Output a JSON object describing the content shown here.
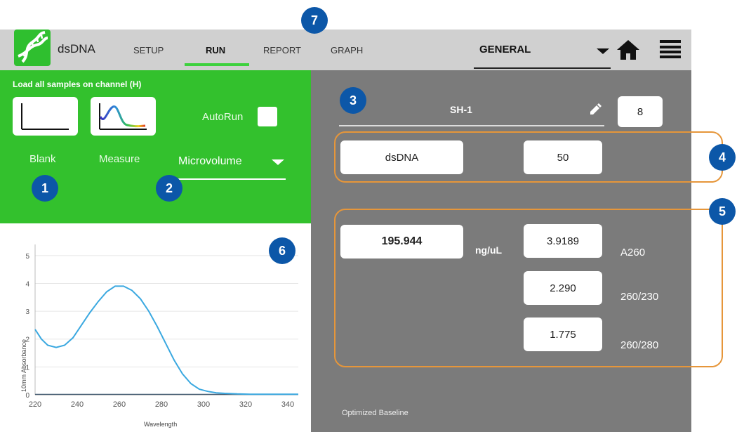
{
  "header": {
    "app_title": "dsDNA",
    "tabs": [
      {
        "label": "SETUP"
      },
      {
        "label": "RUN"
      },
      {
        "label": "REPORT"
      },
      {
        "label": "GRAPH"
      }
    ],
    "mode_select": "GENERAL",
    "icons": [
      "dna-app-icon",
      "chevron-down-icon",
      "home-icon",
      "hamburger-menu-icon"
    ]
  },
  "left_panel": {
    "instruction": "Load all samples on channel (H)",
    "blank_label": "Blank",
    "measure_label": "Measure",
    "autorun_label": "AutoRun",
    "volume_select": "Microvolume",
    "colors": {
      "panel": "#33c12d"
    }
  },
  "right_panel": {
    "sample_name": "SH-1",
    "sample_count": "8",
    "sample_type": "dsDNA",
    "factor": "50",
    "concentration": "195.944",
    "unit": "ng/uL",
    "results": [
      {
        "value": "3.9189",
        "label": "A260"
      },
      {
        "value": "2.290",
        "label": "260/230"
      },
      {
        "value": "1.775",
        "label": "260/280"
      }
    ],
    "baseline": "Optimized Baseline",
    "colors": {
      "panel": "#7b7b7b",
      "highlight": "#e6963a"
    }
  },
  "callouts": [
    "1",
    "2",
    "3",
    "4",
    "5",
    "6",
    "7"
  ],
  "chart_data": {
    "type": "line",
    "xlabel": "Wavelength",
    "ylabel": "10mm Absorbance",
    "xlim": [
      220,
      345
    ],
    "ylim": [
      0,
      5.4
    ],
    "x_ticks": [
      "220",
      "240",
      "260",
      "280",
      "300",
      "320",
      "340"
    ],
    "y_ticks": [
      "0",
      "1",
      "2",
      "3",
      "4",
      "5"
    ],
    "grid": true,
    "series": [
      {
        "color": "#3aa8e0",
        "x": [
          220,
          223,
          226,
          230,
          234,
          238,
          242,
          246,
          250,
          254,
          258,
          262,
          266,
          270,
          274,
          278,
          282,
          286,
          290,
          294,
          298,
          302,
          306,
          310,
          316,
          322,
          330,
          338,
          345
        ],
        "y": [
          2.35,
          2.0,
          1.78,
          1.7,
          1.78,
          2.05,
          2.5,
          2.95,
          3.35,
          3.7,
          3.9,
          3.9,
          3.75,
          3.45,
          3.0,
          2.45,
          1.85,
          1.25,
          0.75,
          0.4,
          0.2,
          0.12,
          0.07,
          0.05,
          0.03,
          0.02,
          0.02,
          0.02,
          0.02
        ]
      }
    ]
  }
}
